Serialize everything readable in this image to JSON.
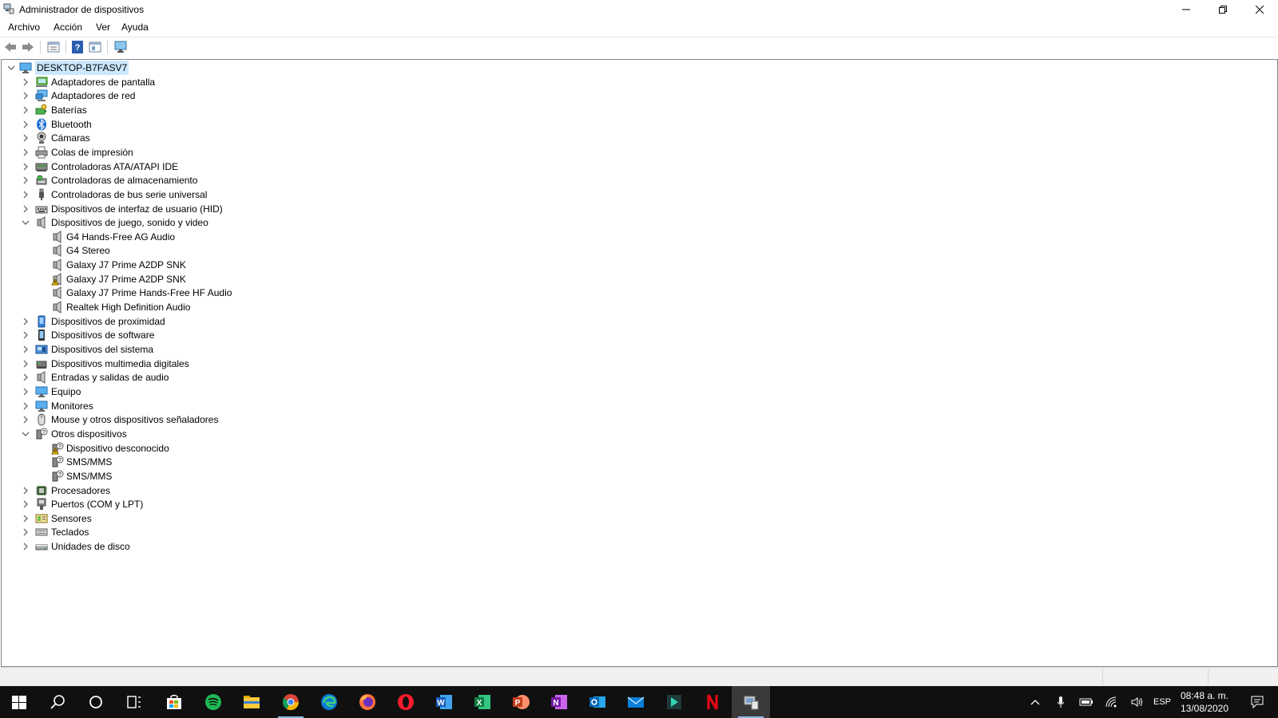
{
  "window": {
    "title": "Administrador de dispositivos",
    "controls": [
      "minimize",
      "restore",
      "close"
    ]
  },
  "menu": [
    "Archivo",
    "Acción",
    "Ver",
    "Ayuda"
  ],
  "toolbar": [
    "back-arrow-icon",
    "forward-arrow-icon",
    "properties-icon",
    "help-icon",
    "update-driver-icon",
    "monitor-scan-icon"
  ],
  "tree": {
    "root": "DESKTOP-B7FASV7",
    "categories": [
      {
        "label": "Adaptadores de pantalla",
        "icon": "display-adapter-icon"
      },
      {
        "label": "Adaptadores de red",
        "icon": "network-adapter-icon"
      },
      {
        "label": "Baterías",
        "icon": "battery-icon"
      },
      {
        "label": "Bluetooth",
        "icon": "bluetooth-icon"
      },
      {
        "label": "Cámaras",
        "icon": "camera-icon"
      },
      {
        "label": "Colas de impresión",
        "icon": "printer-icon"
      },
      {
        "label": "Controladoras ATA/ATAPI IDE",
        "icon": "ide-controller-icon"
      },
      {
        "label": "Controladoras de almacenamiento",
        "icon": "storage-controller-icon"
      },
      {
        "label": "Controladoras de bus serie universal",
        "icon": "usb-icon"
      },
      {
        "label": "Dispositivos de interfaz de usuario (HID)",
        "icon": "hid-icon"
      },
      {
        "label": "Dispositivos de juego, sonido y video",
        "icon": "speaker-icon",
        "expanded": true,
        "children": [
          {
            "label": "G4 Hands-Free AG Audio",
            "icon": "speaker-icon"
          },
          {
            "label": "G4 Stereo",
            "icon": "speaker-icon"
          },
          {
            "label": "Galaxy J7 Prime A2DP SNK",
            "icon": "speaker-icon"
          },
          {
            "label": "Galaxy J7 Prime A2DP SNK",
            "icon": "speaker-warning-icon"
          },
          {
            "label": "Galaxy J7 Prime Hands-Free HF Audio",
            "icon": "speaker-icon"
          },
          {
            "label": "Realtek High Definition Audio",
            "icon": "speaker-icon"
          }
        ]
      },
      {
        "label": "Dispositivos de proximidad",
        "icon": "proximity-icon"
      },
      {
        "label": "Dispositivos de software",
        "icon": "software-device-icon"
      },
      {
        "label": "Dispositivos del sistema",
        "icon": "system-device-icon"
      },
      {
        "label": "Dispositivos multimedia digitales",
        "icon": "multimedia-icon"
      },
      {
        "label": "Entradas y salidas de audio",
        "icon": "speaker-icon"
      },
      {
        "label": "Equipo",
        "icon": "computer-icon"
      },
      {
        "label": "Monitores",
        "icon": "monitor-icon"
      },
      {
        "label": "Mouse y otros dispositivos señaladores",
        "icon": "mouse-icon"
      },
      {
        "label": "Otros dispositivos",
        "icon": "unknown-device-icon",
        "expanded": true,
        "children": [
          {
            "label": "Dispositivo desconocido",
            "icon": "unknown-device-warning-icon"
          },
          {
            "label": "SMS/MMS",
            "icon": "unknown-device-icon"
          },
          {
            "label": "SMS/MMS",
            "icon": "unknown-device-icon"
          }
        ]
      },
      {
        "label": "Procesadores",
        "icon": "processor-icon"
      },
      {
        "label": "Puertos (COM y LPT)",
        "icon": "port-icon"
      },
      {
        "label": "Sensores",
        "icon": "sensor-icon"
      },
      {
        "label": "Teclados",
        "icon": "keyboard-icon"
      },
      {
        "label": "Unidades de disco",
        "icon": "disk-drive-icon"
      }
    ]
  },
  "taskbar": {
    "apps": [
      "windows-start-icon",
      "search-icon",
      "cortana-icon",
      "task-view-icon",
      "store-icon",
      "spotify-icon",
      "file-explorer-icon",
      "chrome-icon",
      "edge-icon",
      "firefox-icon",
      "opera-icon",
      "word-icon",
      "excel-icon",
      "powerpoint-icon",
      "onenote-icon",
      "outlook-icon",
      "mail-icon",
      "filmora-icon",
      "netflix-icon",
      "device-manager-icon"
    ],
    "tray": {
      "language": "ESP",
      "time": "08:48 a. m.",
      "date": "13/08/2020"
    }
  },
  "colors": {
    "selection": "#cce8ff",
    "taskbar": "#101010",
    "active_underline": "#8ab8e6"
  }
}
